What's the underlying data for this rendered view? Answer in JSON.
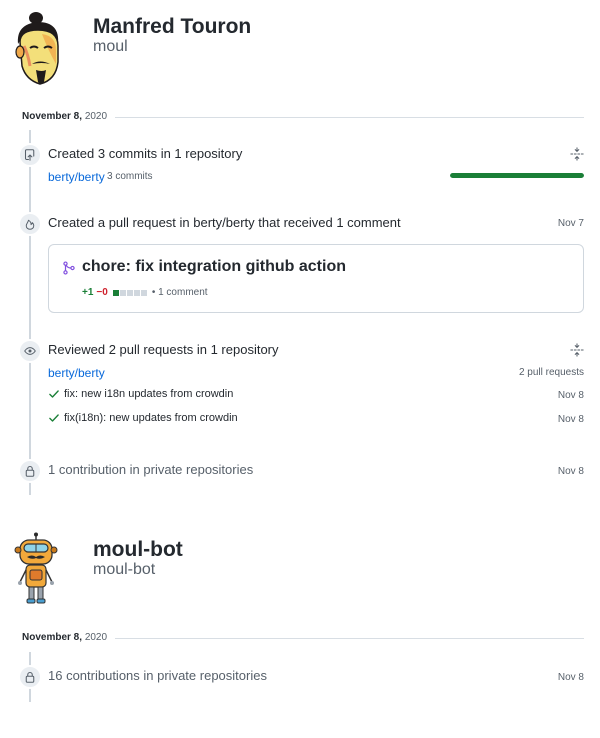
{
  "users": [
    {
      "name": "Manfred Touron",
      "login": "moul",
      "date": {
        "month_day": "November 8,",
        "year": "2020"
      },
      "commits": {
        "title": "Created 3 commits in 1 repository",
        "repo": "berty/berty",
        "count": "3 commits",
        "progress": 1.0
      },
      "pull_request": {
        "title": "Created a pull request in berty/berty that received 1 comment",
        "date": "Nov 7",
        "pr_title": "chore: fix integration github action",
        "additions": "+1",
        "deletions": "−0",
        "comments": "• 1 comment"
      },
      "reviews": {
        "title": "Reviewed 2 pull requests in 1 repository",
        "repo": "berty/berty",
        "count": "2 pull requests",
        "items": [
          {
            "label": "fix: new i18n updates from crowdin",
            "date": "Nov 8"
          },
          {
            "label": "fix(i18n): new updates from crowdin",
            "date": "Nov 8"
          }
        ]
      },
      "private": {
        "title": "1 contribution in private repositories",
        "date": "Nov 8"
      }
    },
    {
      "name": "moul-bot",
      "login": "moul-bot",
      "date": {
        "month_day": "November 8,",
        "year": "2020"
      },
      "private": {
        "title": "16 contributions in private repositories",
        "date": "Nov 8"
      }
    }
  ],
  "colors": {
    "link": "#0969da",
    "progress": "#1a7f37",
    "additions": "#1a7f37",
    "deletions": "#cf222e",
    "pr_icon": "#8250df"
  },
  "icons": {
    "commit": "repo-push-icon",
    "pull_request": "flame-icon",
    "pr_merged": "git-merge-icon",
    "review": "eye-icon",
    "private": "lock-icon",
    "expand": "unfold-icon",
    "check": "check-icon"
  }
}
